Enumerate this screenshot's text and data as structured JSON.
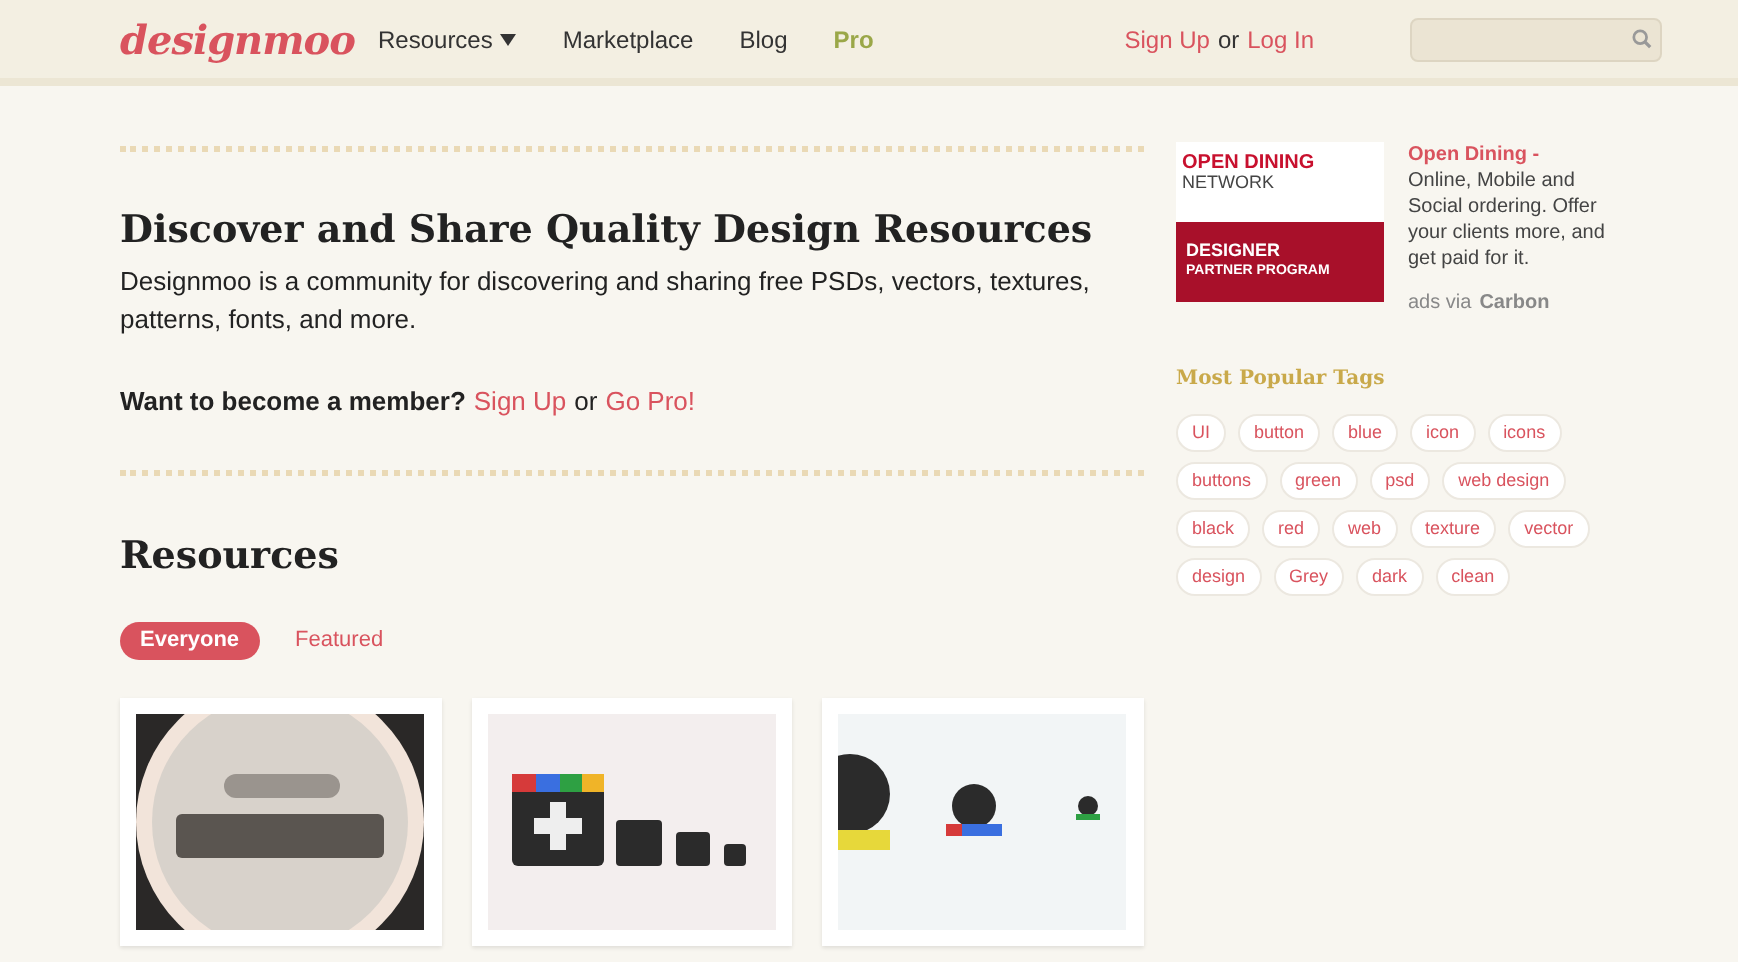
{
  "header": {
    "logo": "designmoo",
    "nav": [
      {
        "label": "Resources",
        "dropdown": true
      },
      {
        "label": "Marketplace",
        "dropdown": false
      },
      {
        "label": "Blog",
        "dropdown": false
      },
      {
        "label": "Pro",
        "dropdown": false
      }
    ],
    "auth": {
      "sign_up": "Sign Up",
      "or": "or",
      "log_in": "Log In"
    }
  },
  "intro": {
    "title": "Discover and Share Quality Design Resources",
    "text": "Designmoo is a community for discovering and sharing free PSDs, vectors, textures, patterns, fonts, and more.",
    "cta": "Want to become a member?",
    "sign_up": "Sign Up",
    "or": "or",
    "go_pro": "Go Pro!"
  },
  "resources": {
    "title": "Resources",
    "filters": [
      {
        "label": "Everyone",
        "selected": true
      },
      {
        "label": "Featured",
        "selected": false
      }
    ]
  },
  "ad": {
    "banner": {
      "line1": "OPEN DINING",
      "line2": "NETWORK",
      "line3": "DESIGNER",
      "line4": "PARTNER PROGRAM"
    },
    "title": "Open Dining -",
    "text": "Online, Mobile and Social ordering. Offer your clients more, and get paid for it.",
    "via": "ads via",
    "carbon": "Carbon"
  },
  "tags": {
    "title": "Most Popular Tags",
    "items": [
      "UI",
      "button",
      "blue",
      "icon",
      "icons",
      "buttons",
      "green",
      "psd",
      "web design",
      "black",
      "red",
      "web",
      "texture",
      "vector",
      "design",
      "Grey",
      "dark",
      "clean"
    ]
  }
}
